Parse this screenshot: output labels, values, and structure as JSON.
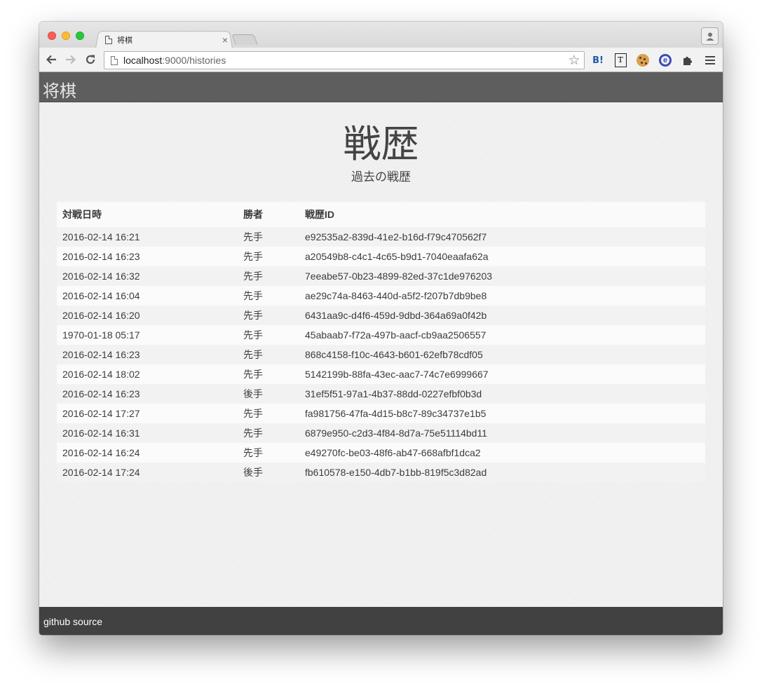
{
  "browser": {
    "tab_title": "将棋",
    "tab_close": "×",
    "url_host": "localhost",
    "url_path": ":9000/histories",
    "nav": {
      "back": "←",
      "forward": "→",
      "reload": "↻"
    },
    "star": "☆",
    "extensions": {
      "hatena": "B!",
      "t_icon": "T"
    }
  },
  "app": {
    "brand": "将棋",
    "title": "戦歴",
    "subtitle": "過去の戦歴",
    "footer_link": "github source"
  },
  "table": {
    "headers": [
      "対戦日時",
      "勝者",
      "戦歴ID"
    ],
    "rows": [
      {
        "date": "2016-02-14 16:21",
        "winner": "先手",
        "id": "e92535a2-839d-41e2-b16d-f79c470562f7"
      },
      {
        "date": "2016-02-14 16:23",
        "winner": "先手",
        "id": "a20549b8-c4c1-4c65-b9d1-7040eaafa62a"
      },
      {
        "date": "2016-02-14 16:32",
        "winner": "先手",
        "id": "7eeabe57-0b23-4899-82ed-37c1de976203"
      },
      {
        "date": "2016-02-14 16:04",
        "winner": "先手",
        "id": "ae29c74a-8463-440d-a5f2-f207b7db9be8"
      },
      {
        "date": "2016-02-14 16:20",
        "winner": "先手",
        "id": "6431aa9c-d4f6-459d-9dbd-364a69a0f42b"
      },
      {
        "date": "1970-01-18 05:17",
        "winner": "先手",
        "id": "45abaab7-f72a-497b-aacf-cb9aa2506557"
      },
      {
        "date": "2016-02-14 16:23",
        "winner": "先手",
        "id": "868c4158-f10c-4643-b601-62efb78cdf05"
      },
      {
        "date": "2016-02-14 18:02",
        "winner": "先手",
        "id": "5142199b-88fa-43ec-aac7-74c7e6999667"
      },
      {
        "date": "2016-02-14 16:23",
        "winner": "後手",
        "id": "31ef5f51-97a1-4b37-88dd-0227efbf0b3d"
      },
      {
        "date": "2016-02-14 17:27",
        "winner": "先手",
        "id": "fa981756-47fa-4d15-b8c7-89c34737e1b5"
      },
      {
        "date": "2016-02-14 16:31",
        "winner": "先手",
        "id": "6879e950-c2d3-4f84-8d7a-75e51114bd11"
      },
      {
        "date": "2016-02-14 16:24",
        "winner": "先手",
        "id": "e49270fc-be03-48f6-ab47-668afbf1dca2"
      },
      {
        "date": "2016-02-14 17:24",
        "winner": "後手",
        "id": "fb610578-e150-4db7-b1bb-819f5c3d82ad"
      }
    ]
  },
  "colors": {
    "navbar": "#5e5e5e",
    "footer": "#414141",
    "text": "#3c3c3c"
  }
}
